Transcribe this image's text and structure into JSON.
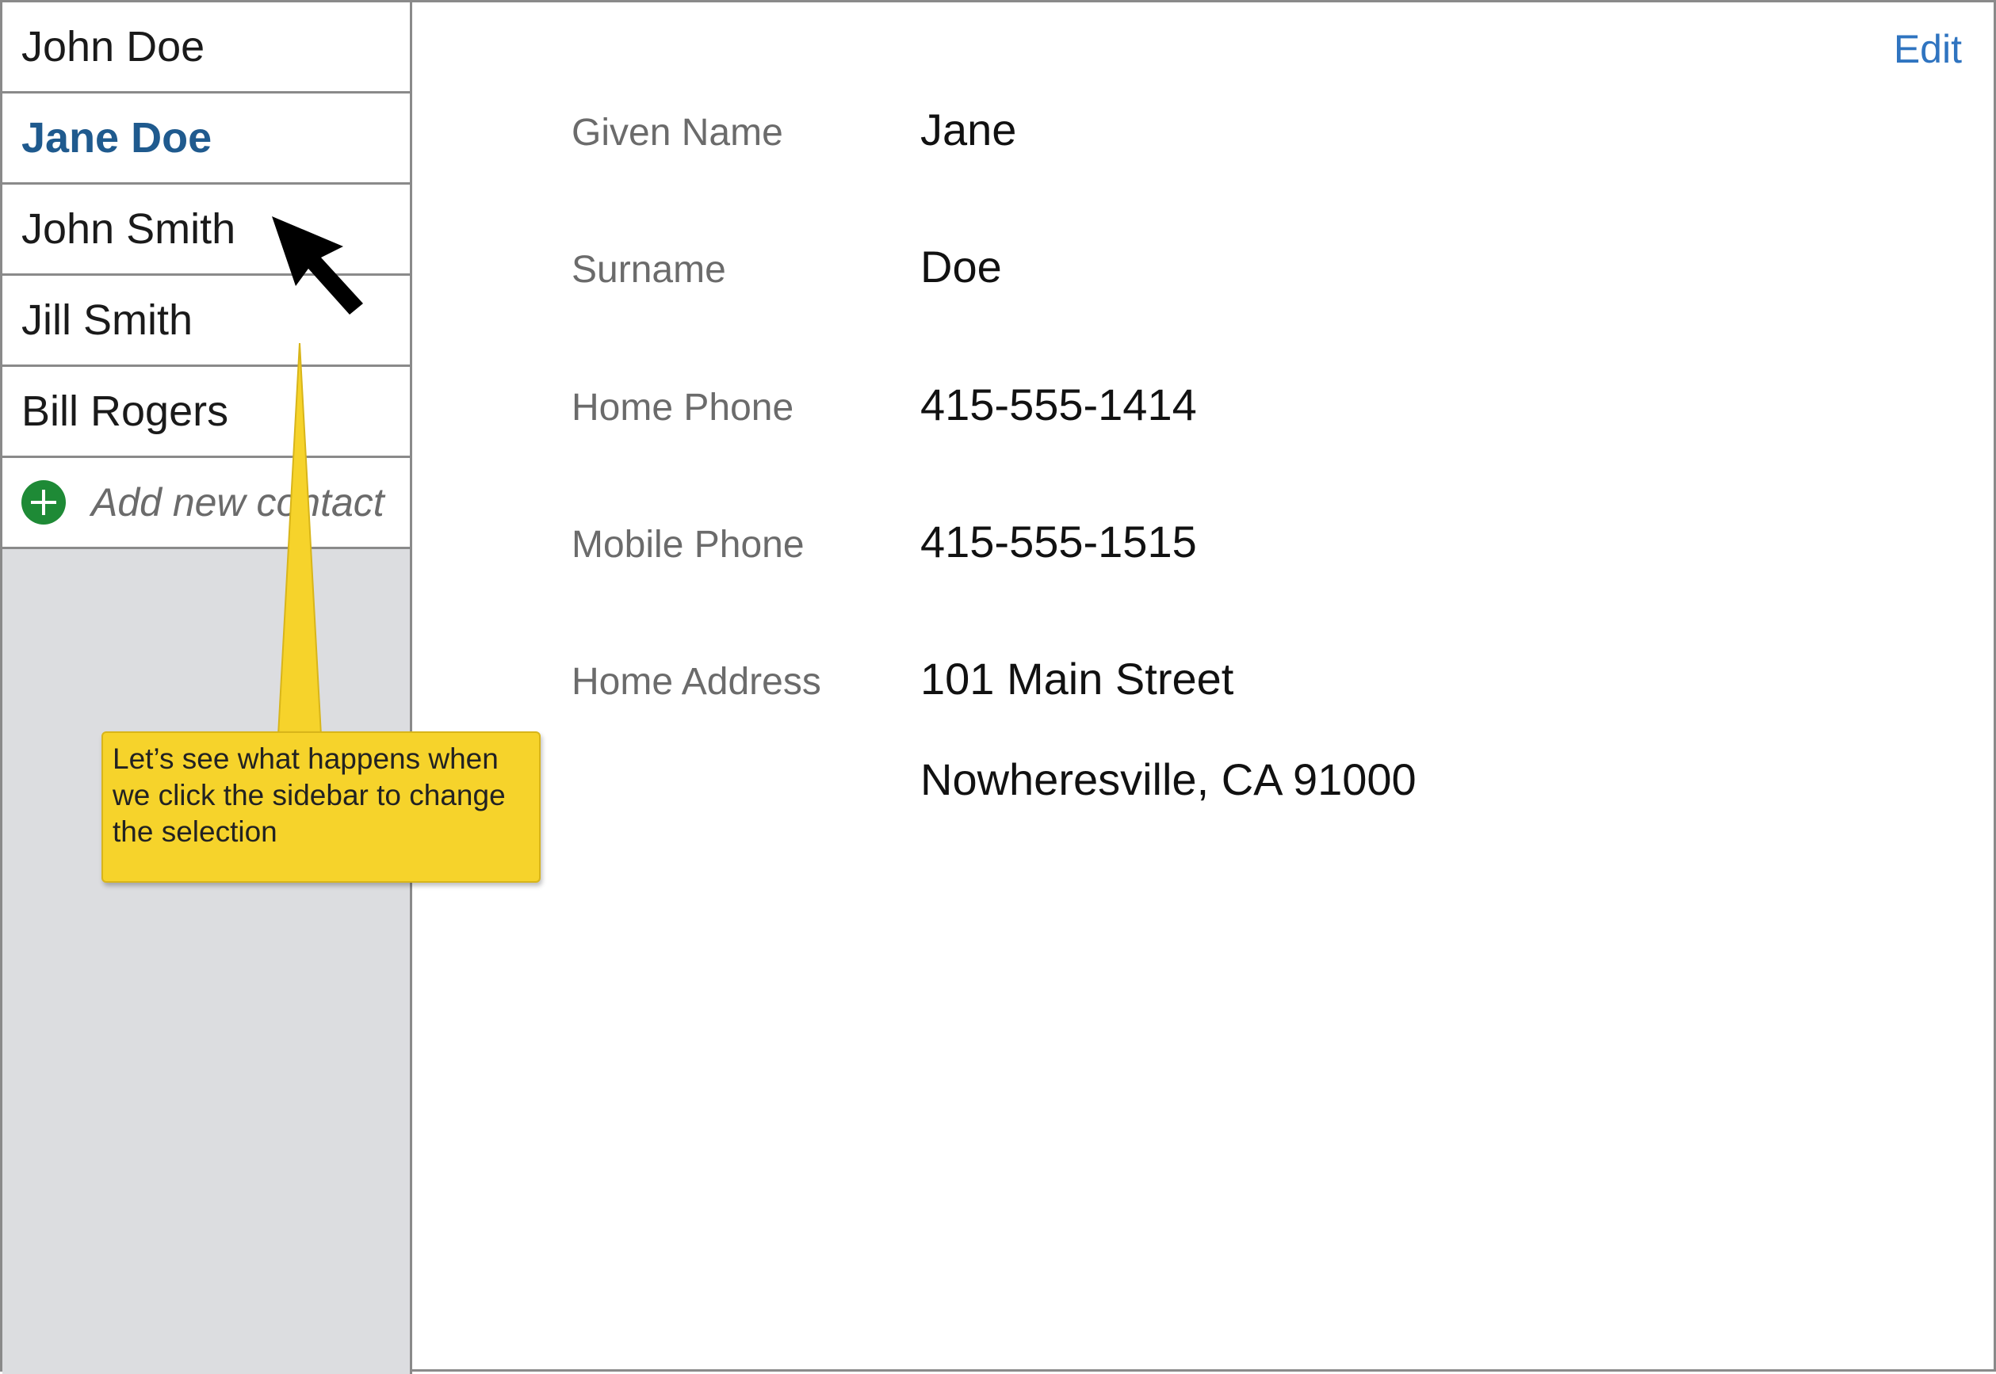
{
  "sidebar": {
    "contacts": [
      {
        "name": "John Doe",
        "selected": false
      },
      {
        "name": "Jane Doe",
        "selected": true
      },
      {
        "name": "John Smith",
        "selected": false
      },
      {
        "name": "Jill Smith",
        "selected": false
      },
      {
        "name": "Bill Rogers",
        "selected": false
      }
    ],
    "add_label": "Add new contact",
    "add_icon": "plus-circle-icon"
  },
  "header": {
    "edit_label": "Edit"
  },
  "details": {
    "given_name": {
      "label": "Given Name",
      "value": "Jane"
    },
    "surname": {
      "label": "Surname",
      "value": "Doe"
    },
    "home_phone": {
      "label": "Home Phone",
      "value": "415-555-1414"
    },
    "mobile_phone": {
      "label": "Mobile Phone",
      "value": "415-555-1515"
    },
    "home_address": {
      "label": "Home Address",
      "line1": "101 Main Street",
      "line2": "Nowheresville, CA 91000"
    }
  },
  "callout": {
    "text": "Let’s see what happens when we click the sidebar to change the selection"
  },
  "colors": {
    "selected": "#1f5a8e",
    "link": "#2f74c0",
    "add_icon": "#1e8a36",
    "callout": "#f6d32b",
    "sidebar_bg": "#dcdde0"
  }
}
